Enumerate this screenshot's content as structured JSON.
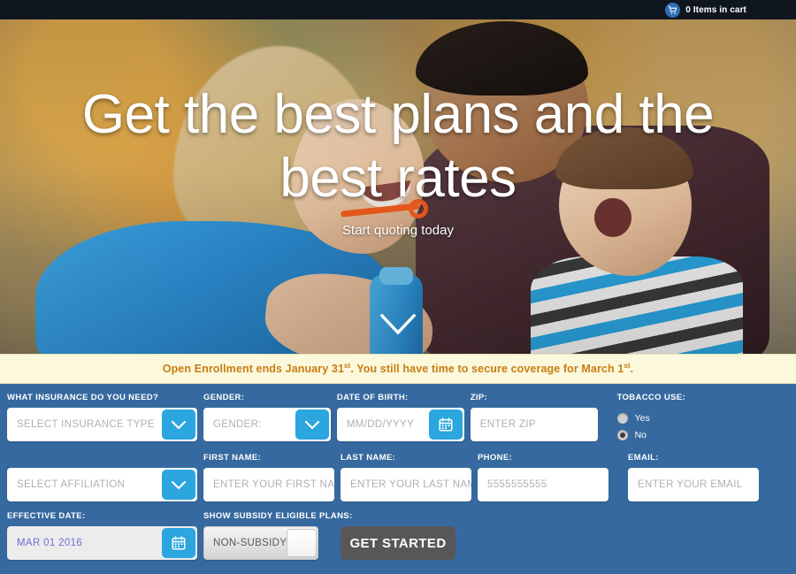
{
  "topbar": {
    "cart_icon": "shopping-cart-icon",
    "cart_label": "0 Items in cart"
  },
  "hero": {
    "title": "Get the best plans and the best rates",
    "subtitle": "Start quoting today",
    "scroll_icon": "chevron-down-icon"
  },
  "notice": {
    "part1": "Open Enrollment ends January 31",
    "sup1": "st",
    "part2": ".   You still have time to secure coverage for March 1",
    "sup2": "st",
    "part3": "."
  },
  "form": {
    "insurance_type": {
      "label": "WHAT INSURANCE DO YOU NEED?",
      "value": "SELECT INSURANCE TYPE",
      "icon": "chevron-down-icon"
    },
    "gender": {
      "label": "GENDER:",
      "value": "GENDER:",
      "icon": "chevron-down-icon"
    },
    "dob": {
      "label": "DATE OF BIRTH:",
      "value": "MM/DD/YYYY",
      "icon": "calendar-icon"
    },
    "zip": {
      "label": "ZIP:",
      "value": "ENTER ZIP"
    },
    "tobacco": {
      "label": "TOBACCO USE:",
      "options": [
        {
          "label": "Yes",
          "selected": false
        },
        {
          "label": "No",
          "selected": true
        }
      ]
    },
    "affiliation": {
      "value": "SELECT AFFILIATION",
      "icon": "chevron-down-icon"
    },
    "first_name": {
      "label": "FIRST NAME:",
      "value": "ENTER YOUR FIRST NAME"
    },
    "last_name": {
      "label": "LAST NAME:",
      "value": "ENTER YOUR LAST NAME"
    },
    "phone": {
      "label": "PHONE:",
      "value": "5555555555"
    },
    "email": {
      "label": "EMAIL:",
      "value": "ENTER YOUR EMAIL"
    },
    "effective_date": {
      "label": "EFFECTIVE DATE:",
      "value": "MAR 01 2016",
      "icon": "calendar-icon"
    },
    "subsidy": {
      "label": "SHOW SUBSIDY ELIGIBLE PLANS:",
      "value": "NON-SUBSIDY"
    },
    "submit_label": "GET STARTED"
  },
  "colors": {
    "topbar_bg": "#10161f",
    "form_bg": "#36699f",
    "accent_blue": "#2ba6de",
    "notice_bg": "#fbf8dc",
    "notice_text": "#c97d13",
    "submit_bg": "#575757"
  }
}
